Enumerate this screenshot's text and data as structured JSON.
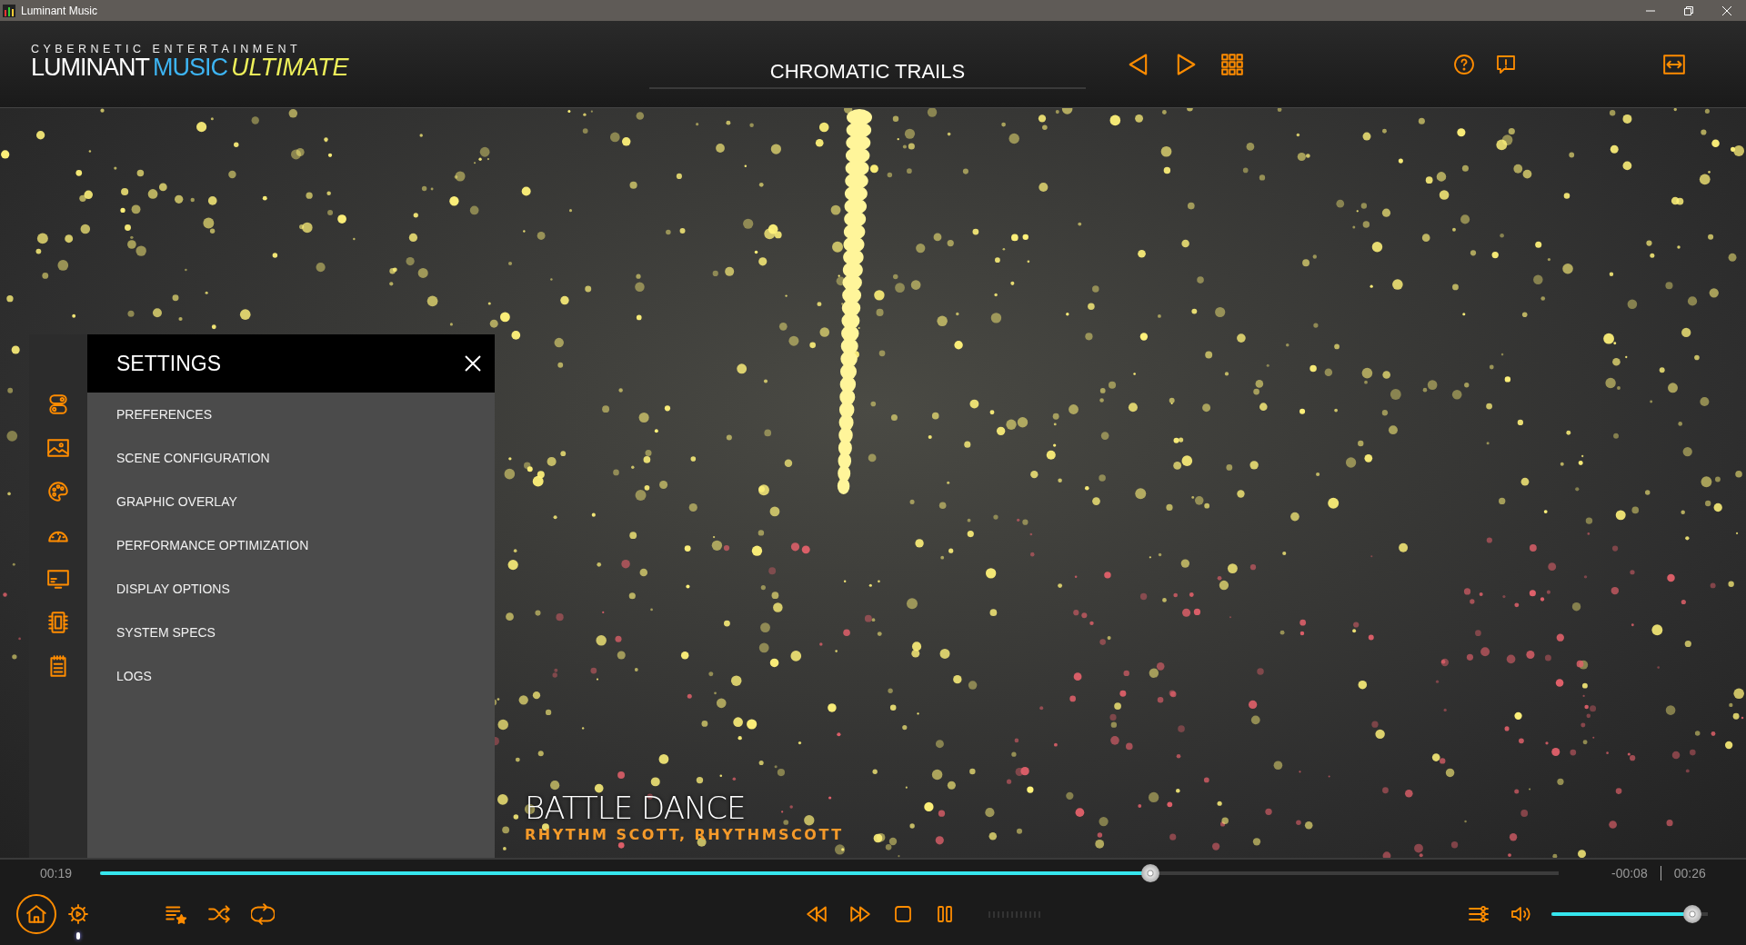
{
  "window": {
    "title": "Luminant Music"
  },
  "logo": {
    "tagline": "CYBERNETIC ENTERTAINMENT",
    "name": "LUMINANT",
    "product": "MUSIC",
    "edition": "ULTIMATE"
  },
  "scene": {
    "title": "CHROMATIC TRAILS"
  },
  "settings": {
    "title": "SETTINGS",
    "items": [
      {
        "label": "PREFERENCES"
      },
      {
        "label": "SCENE CONFIGURATION"
      },
      {
        "label": "GRAPHIC OVERLAY"
      },
      {
        "label": "PERFORMANCE OPTIMIZATION"
      },
      {
        "label": "DISPLAY OPTIONS"
      },
      {
        "label": "SYSTEM SPECS"
      },
      {
        "label": "LOGS"
      }
    ]
  },
  "now_playing": {
    "title": "BATTLE DANCE",
    "artist": "RHYTHM SCOTT, RHYTHMSCOTT"
  },
  "playback": {
    "elapsed": "00:19",
    "remaining": "-00:08",
    "duration": "00:26",
    "level": 0.72
  },
  "volume": {
    "level": 0.9
  }
}
